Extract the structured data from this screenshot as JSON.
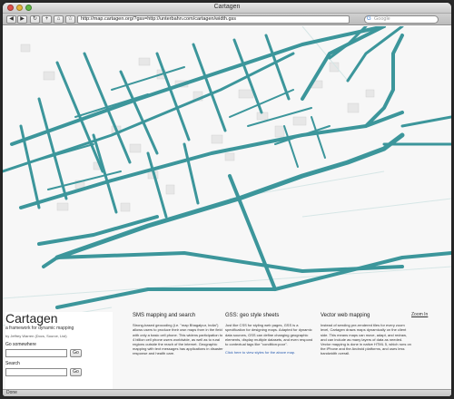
{
  "window": {
    "title": "Cartagen"
  },
  "toolbar": {
    "back_label": "◀",
    "forward_label": "▶",
    "refresh_label": "↻",
    "add_label": "+",
    "home_label": "⌂",
    "bookmark_label": "☆",
    "url": "http://map.cartagen.org/?gss=http://unterbahn.com/cartagen/width.gss",
    "search_placeholder": "Google",
    "search_engine_icon": "G"
  },
  "map": {
    "road_color": "#3c969b",
    "background_color": "#f7f7f7",
    "building_color": "#e9e9e9",
    "zoom_link": "Zoom In"
  },
  "brand": {
    "title": "Cartagen",
    "tagline": "a framework for dynamic mapping",
    "byline": "by Jeffrey Warren (Docs, Source, List)",
    "go_somewhere_label": "Go somewhere",
    "go_label": "Go",
    "search_label": "Search",
    "search_go_label": "Go"
  },
  "columns": [
    {
      "heading": "SMS mapping and search",
      "paragraphs": [
        "Strong-based geocoding (i.e. \"map Bhagalpur, India\") allows users to produce their own maps from in the field with only a basic cell phone. This widens participation to 4 billion cell phone users worldwide, as well as to rural regions outside the reach of the internet. Geographic mapping with text messages has applications in disaster response and health care."
      ]
    },
    {
      "heading": "GSS: geo style sheets",
      "paragraphs": [
        "Just like CSS for styling web pages, GSS is a specification for designing maps. Adapted for dynamic data sources, GSS can define changing geographic elements, display multiple datasets, and even respond to contextual tags like \"condition:poor\".",
        "Click here to view styles for the above map."
      ]
    },
    {
      "heading": "Vector web mapping",
      "paragraphs": [
        "Instead of sending pre-rendered tiles for every zoom level, Cartagen draws maps dynamically on the client side. This means maps can move, adapt, and redraw, and can include as many layers of data as needed. Vector mapping is done in native HTML 5, which runs on the iPhone and the Android platforms, and uses less bandwidth overall."
      ]
    }
  ],
  "status": {
    "text": "Done"
  }
}
